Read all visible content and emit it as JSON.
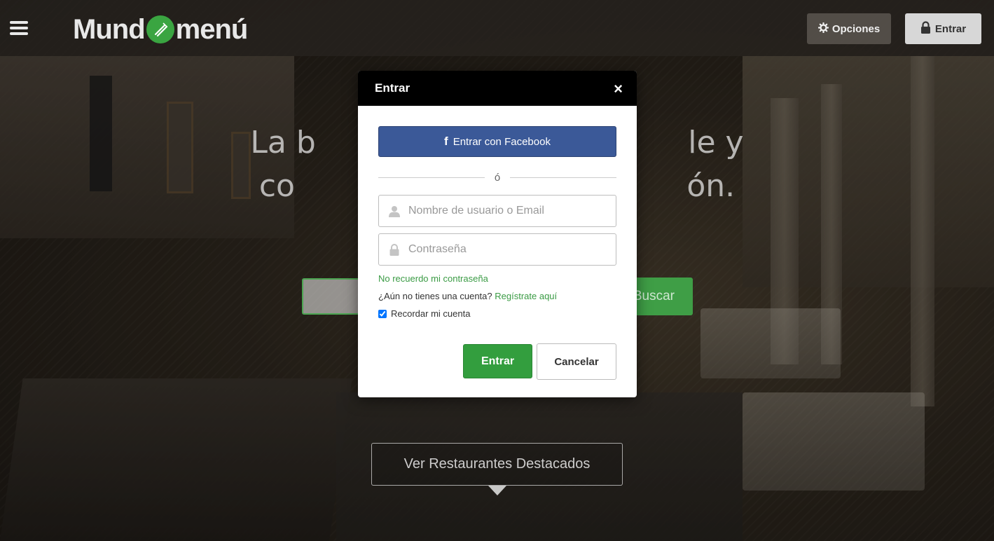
{
  "header": {
    "logo_left": "Mund",
    "logo_right": "menú",
    "options_label": "Opciones",
    "login_label": "Entrar"
  },
  "hero": {
    "line1": "La b                                      le y",
    "line2": "co                                        ón.",
    "search_button": "Buscar",
    "featured_button": "Ver Restaurantes Destacados"
  },
  "modal": {
    "title": "Entrar",
    "close": "×",
    "facebook_button": "Entrar con Facebook",
    "divider": "ó",
    "username_placeholder": "Nombre de usuario o Email",
    "password_placeholder": "Contraseña",
    "forgot_link": "No recuerdo mi contraseña",
    "register_prompt": "¿Aún no tienes una cuenta?",
    "register_link": "Regístrate aquí",
    "remember_label": "Recordar mi cuenta",
    "remember_checked": true,
    "submit_button": "Entrar",
    "cancel_button": "Cancelar"
  },
  "colors": {
    "brand_green": "#339e3e",
    "facebook_blue": "#3b5998",
    "modal_header": "#000000"
  }
}
